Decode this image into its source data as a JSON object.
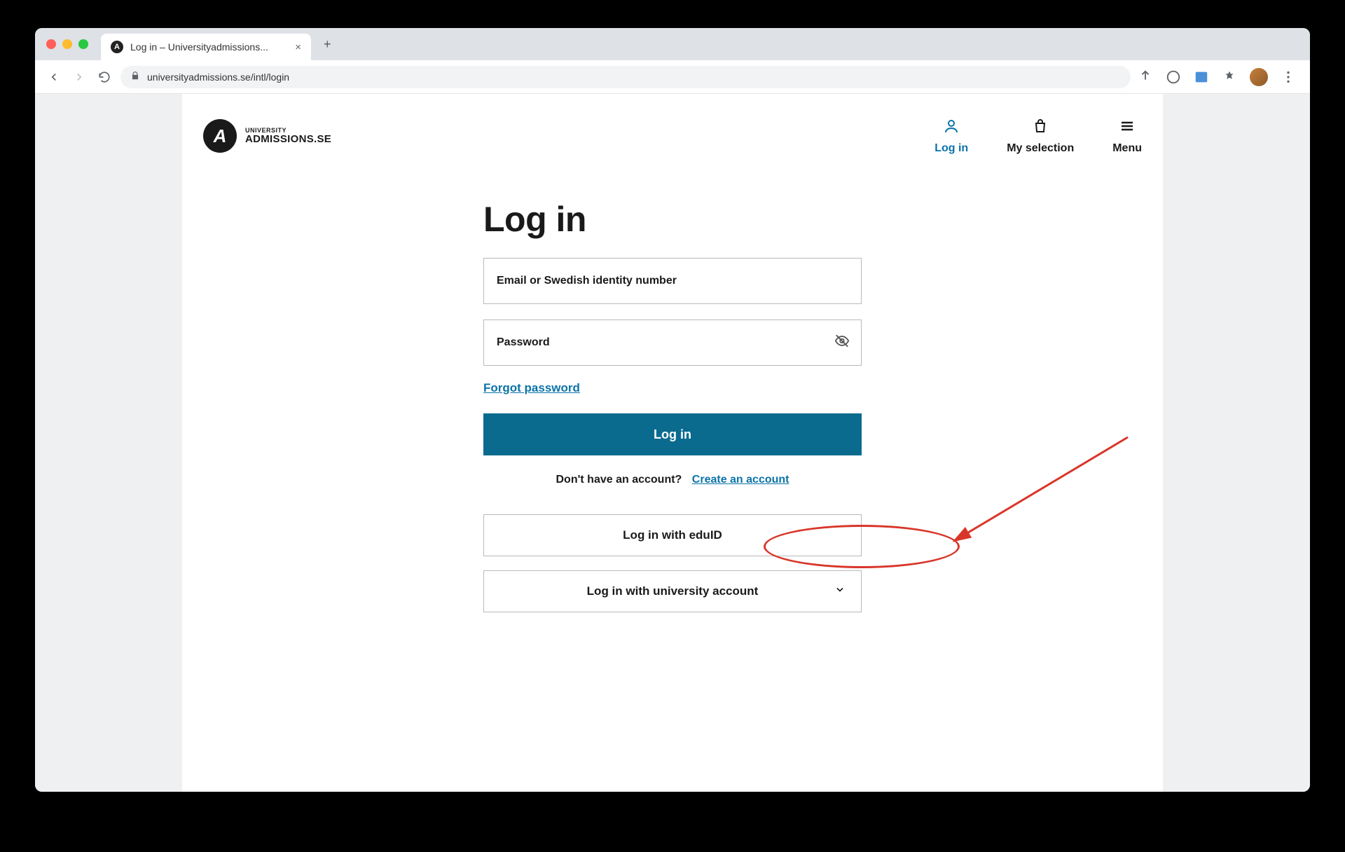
{
  "browser": {
    "tab_title": "Log in – Universityadmissions...",
    "url": "universityadmissions.se/intl/login"
  },
  "brand": {
    "top": "UNIVERSITY",
    "main": "ADMISSIONS.SE"
  },
  "nav": {
    "login": "Log in",
    "selection": "My selection",
    "menu": "Menu"
  },
  "login": {
    "title": "Log in",
    "email_placeholder": "Email or Swedish identity number",
    "password_placeholder": "Password",
    "forgot": "Forgot password",
    "submit": "Log in",
    "no_account": "Don't have an account?",
    "create": "Create an account",
    "eduid": "Log in with eduID",
    "university": "Log in with university account"
  }
}
